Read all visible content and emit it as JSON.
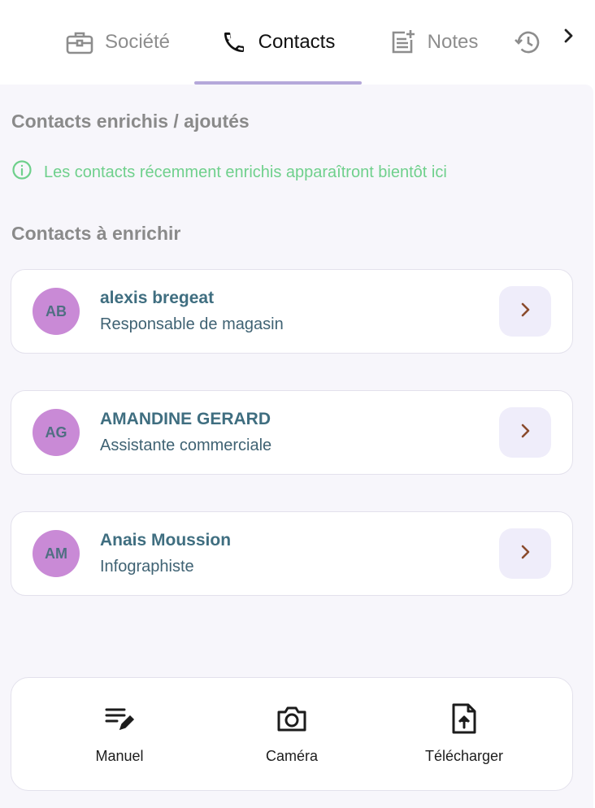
{
  "tabs": [
    {
      "label": "Société",
      "icon": "briefcase-icon"
    },
    {
      "label": "Contacts",
      "icon": "phone-icon",
      "active": true
    },
    {
      "label": "Notes",
      "icon": "note-add-icon"
    },
    {
      "label": "",
      "icon": "history-icon"
    }
  ],
  "colors": {
    "accent": "#b5a8da",
    "info": "#6fd08c",
    "avatar_bg": "#c98ad6",
    "name_text": "#3f6e80",
    "panel_bg": "#f7f6fb",
    "chevron": "#8a4b2d"
  },
  "enriched_section": {
    "title": "Contacts enrichis / ajoutés",
    "info_text": "Les contacts récemment enrichis apparaîtront bientôt ici"
  },
  "to_enrich_section": {
    "title": "Contacts à enrichir",
    "contacts": [
      {
        "initials": "AB",
        "name": "alexis bregeat",
        "role": "Responsable de magasin"
      },
      {
        "initials": "AG",
        "name": "AMANDINE GERARD",
        "role": "Assistante commerciale"
      },
      {
        "initials": "AM",
        "name": "Anais Moussion",
        "role": "Infographiste"
      }
    ]
  },
  "actions": [
    {
      "label": "Manuel",
      "icon": "edit-list-icon"
    },
    {
      "label": "Caméra",
      "icon": "camera-icon"
    },
    {
      "label": "Télécharger",
      "icon": "file-upload-icon"
    }
  ]
}
